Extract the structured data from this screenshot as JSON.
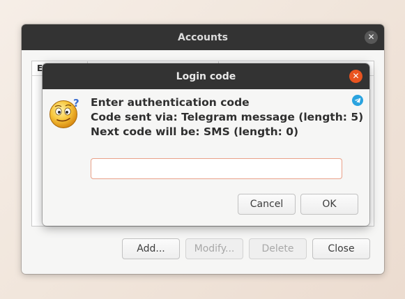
{
  "accounts_window": {
    "title": "Accounts",
    "close_glyph": "✕",
    "table_header": "E",
    "buttons": {
      "add": "Add...",
      "modify": "Modify...",
      "delete": "Delete",
      "close": "Close"
    }
  },
  "login_dialog": {
    "title": "Login code",
    "close_glyph": "✕",
    "lines": {
      "heading": "Enter authentication code",
      "sent_via": "Code sent via: Telegram message (length: 5)",
      "next_code": "Next code will be: SMS (length: 0)"
    },
    "code_input": {
      "value": "",
      "placeholder": ""
    },
    "buttons": {
      "cancel": "Cancel",
      "ok": "OK"
    }
  },
  "icons": {
    "dialog_icon": "confused-smiley-icon",
    "account_icon": "telegram-icon"
  },
  "colors": {
    "titlebar": "#333333",
    "accent_close": "#e95420",
    "input_focus_border": "#e9a088",
    "telegram_blue": "#2aa3df"
  }
}
